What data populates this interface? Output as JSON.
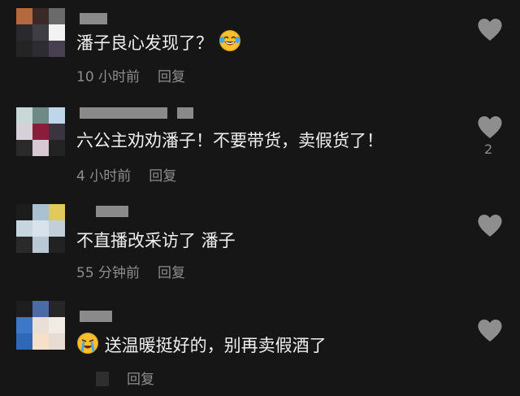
{
  "comments": [
    {
      "text": "潘子良心发现了？",
      "time": "10 小时前",
      "reply_label": "回复",
      "emoji": "laughing-crying-emoji",
      "emoji_position": "end",
      "likes": ""
    },
    {
      "text": "六公主劝劝潘子！不要带货，卖假货了！",
      "time": "4 小时前",
      "reply_label": "回复",
      "likes": "2"
    },
    {
      "text": "不直播改采访了 潘子",
      "time": "55 分钟前",
      "reply_label": "回复",
      "likes": ""
    },
    {
      "text": "送温暖挺好的，别再卖假酒了",
      "time": "",
      "reply_label": "回复",
      "emoji": "crying-emoji",
      "emoji_position": "start",
      "likes": ""
    }
  ],
  "colors": {
    "background": "#161616",
    "text": "#efefef",
    "meta": "#8d8d8d",
    "heart": "#8e8e8e"
  },
  "icons": [
    "heart-icon"
  ]
}
